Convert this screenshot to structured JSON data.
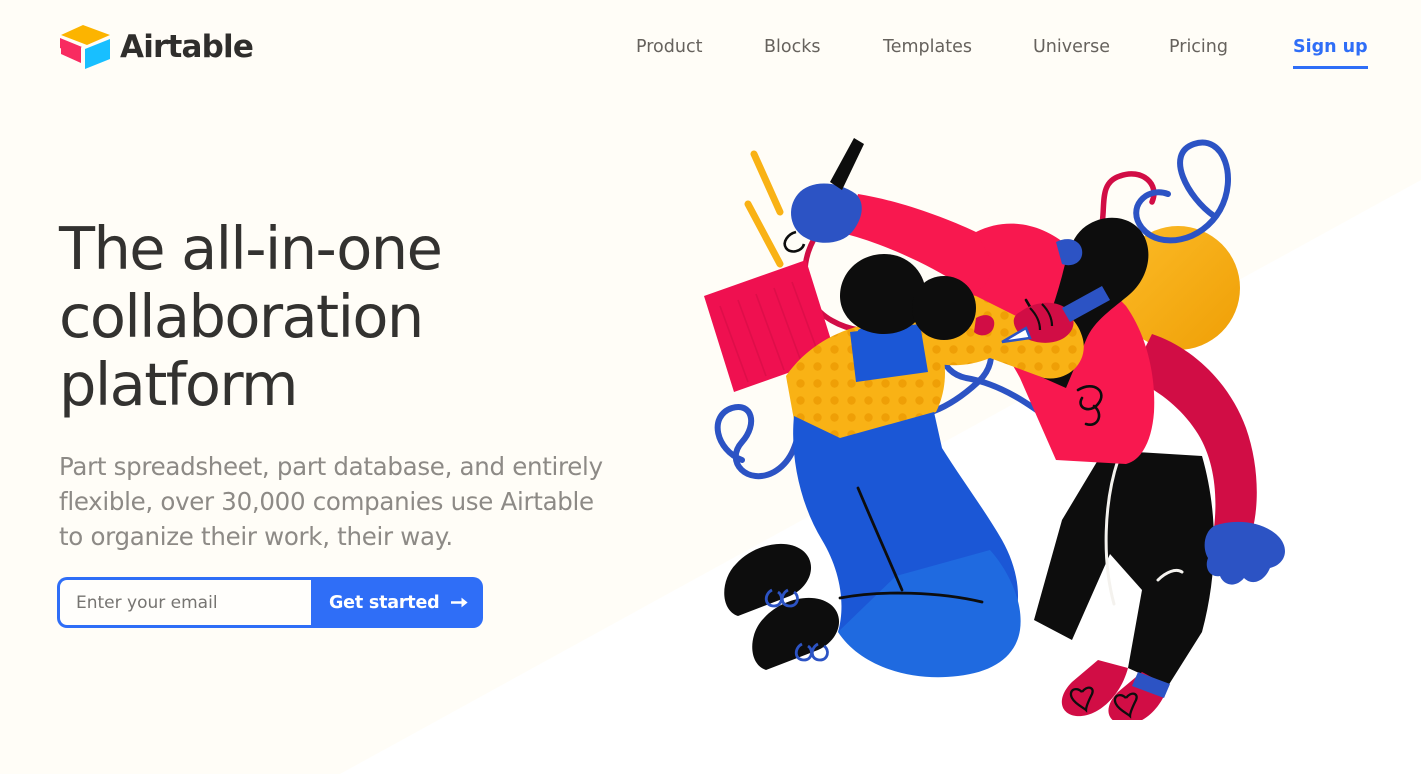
{
  "page": {
    "background_color": "#fffdf7",
    "wedge_color": "#ffffff"
  },
  "header": {
    "logo": {
      "icon_name": "airtable-logo-icon",
      "text": "Airtable",
      "colors": {
        "top": "#fcb400",
        "left": "#f82b60",
        "right": "#18bfff",
        "wordmark": "#2f2e2c"
      }
    },
    "nav": {
      "items": [
        {
          "label": "Product"
        },
        {
          "label": "Blocks"
        },
        {
          "label": "Templates"
        },
        {
          "label": "Universe"
        },
        {
          "label": "Pricing"
        }
      ],
      "signup": {
        "label": "Sign up",
        "color": "#2f6ef7",
        "underlined": true
      },
      "item_color": "#66625d"
    }
  },
  "hero": {
    "title": "The all-in-one collaboration platform",
    "subtitle": "Part spreadsheet, part database, and entirely flexible, over 30,000 companies use Airtable to organize their work, their way.",
    "title_color": "#333230",
    "subtitle_color": "#8d8a86"
  },
  "signup_form": {
    "email_placeholder": "Enter your email",
    "email_value": "",
    "cta_label": "Get started",
    "cta_arrow_icon": "arrow-right-icon",
    "accent_color": "#2f6ef7",
    "field_background": "#fffefb"
  },
  "illustration": {
    "name": "two-people-drawing-illustration",
    "palette": {
      "pink": "#f8184f",
      "crimson": "#d10d45",
      "blue": "#2c53c4",
      "overall_blue": "#1b57d6",
      "bright_blue": "#1f6ae0",
      "yellow": "#f9b215",
      "amber": "#f0a500",
      "black": "#0d0d0d",
      "white": "#ffffff"
    },
    "elements": [
      "yellow-circle",
      "blue-squiggle-loop",
      "crimson-squiggle-line",
      "yellow-streak-marks",
      "standing-figure-pink-shirt",
      "kneeling-figure-blue-overalls",
      "yellow-polka-dot-sleeve",
      "crimson-paper-square",
      "black-pen",
      "blue-pencil"
    ]
  }
}
